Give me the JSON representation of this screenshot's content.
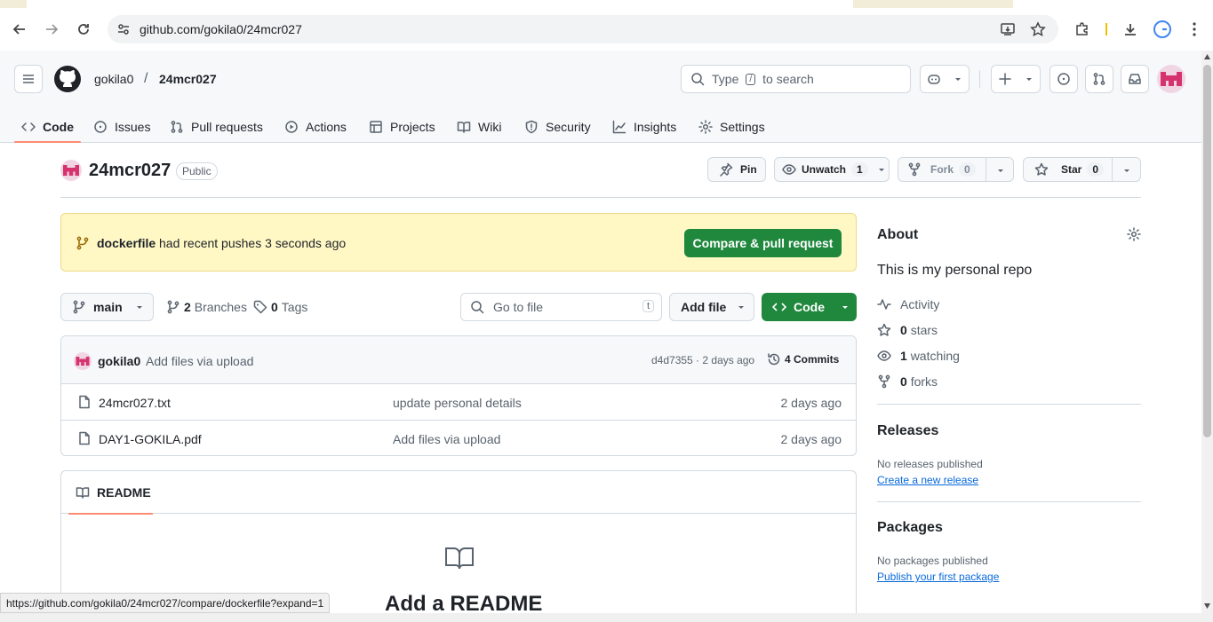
{
  "browser": {
    "url": "github.com/gokila0/24mcr027",
    "status_url": "https://github.com/gokila0/24mcr027/compare/dockerfile?expand=1"
  },
  "header": {
    "owner": "gokila0",
    "separator": "/",
    "repo": "24mcr027",
    "search_prefix": "Type",
    "search_key": "/",
    "search_suffix": "to search"
  },
  "tabs": [
    {
      "label": "Code"
    },
    {
      "label": "Issues"
    },
    {
      "label": "Pull requests"
    },
    {
      "label": "Actions"
    },
    {
      "label": "Projects"
    },
    {
      "label": "Wiki"
    },
    {
      "label": "Security"
    },
    {
      "label": "Insights"
    },
    {
      "label": "Settings"
    }
  ],
  "repo": {
    "name": "24mcr027",
    "visibility": "Public",
    "pin_label": "Pin",
    "unwatch_label": "Unwatch",
    "watch_count": "1",
    "fork_label": "Fork",
    "fork_count": "0",
    "star_label": "Star",
    "star_count": "0"
  },
  "banner": {
    "branch": "dockerfile",
    "text": "had recent pushes 3 seconds ago",
    "button": "Compare & pull request"
  },
  "toolbar": {
    "branch": "main",
    "branches_count": "2",
    "branches_label": "Branches",
    "tags_count": "0",
    "tags_label": "Tags",
    "goto_placeholder": "Go to file",
    "goto_key": "t",
    "add_file": "Add file",
    "code": "Code"
  },
  "commit": {
    "author": "gokila0",
    "message": "Add files via upload",
    "hash_time": "d4d7355 · 2 days ago",
    "commits": "4 Commits"
  },
  "files": [
    {
      "name": "24mcr027.txt",
      "message": "update personal details",
      "time": "2 days ago"
    },
    {
      "name": "DAY1-GOKILA.pdf",
      "message": "Add files via upload",
      "time": "2 days ago"
    }
  ],
  "readme": {
    "tab": "README",
    "heading": "Add a README"
  },
  "about": {
    "title": "About",
    "description": "This is my personal repo",
    "activity": "Activity",
    "stars_count": "0",
    "stars_label": "stars",
    "watching_count": "1",
    "watching_label": "watching",
    "forks_count": "0",
    "forks_label": "forks"
  },
  "releases": {
    "title": "Releases",
    "empty": "No releases published",
    "link": "Create a new release"
  },
  "packages": {
    "title": "Packages",
    "empty": "No packages published",
    "link": "Publish your first package"
  },
  "colors": {
    "primary_green": "#1f883d",
    "banner_bg": "#fff8c5",
    "accent_tab": "#fd8c73",
    "link": "#0969da"
  }
}
